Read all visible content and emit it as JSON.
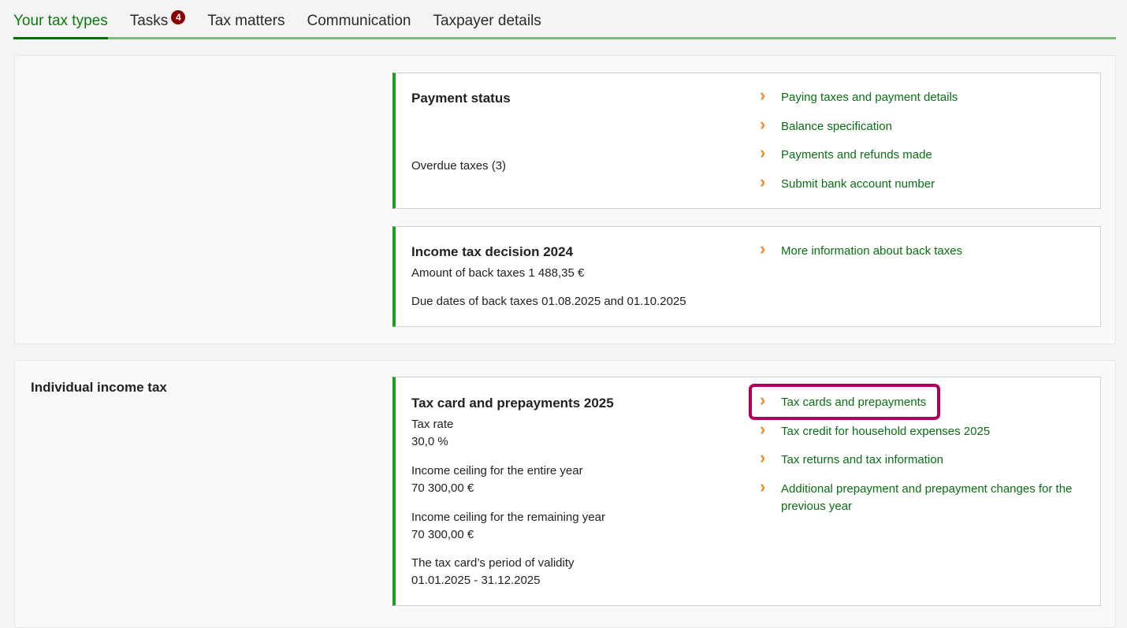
{
  "tabs": [
    {
      "label": "Your tax types",
      "active": true
    },
    {
      "label": "Tasks",
      "badge": "4"
    },
    {
      "label": "Tax matters"
    },
    {
      "label": "Communication"
    },
    {
      "label": "Taxpayer details"
    }
  ],
  "payment": {
    "title": "Payment status",
    "overdue": "Overdue taxes (3)",
    "links": [
      "Paying taxes and payment details",
      "Balance specification",
      "Payments and refunds made",
      "Submit bank account number"
    ]
  },
  "decision": {
    "title": "Income tax decision 2024",
    "amount": "Amount of back taxes 1 488,35 €",
    "due": "Due dates of back taxes 01.08.2025 and 01.10.2025",
    "links": [
      "More information about back taxes"
    ]
  },
  "income": {
    "section_title": "Individual income tax",
    "title": "Tax card and prepayments 2025",
    "rate_label": "Tax rate",
    "rate": "30,0 %",
    "ceiling_year_label": "Income ceiling for the entire year",
    "ceiling_year": "70 300,00 €",
    "ceiling_rem_label": "Income ceiling for the remaining year",
    "ceiling_rem": "70 300,00 €",
    "validity_label": "The tax card’s period of validity",
    "validity": "01.01.2025 - 31.12.2025",
    "links": [
      "Tax cards and prepayments",
      "Tax credit for household expenses 2025",
      "Tax returns and tax information",
      "Additional prepayment and prepayment changes for the previous year"
    ]
  }
}
